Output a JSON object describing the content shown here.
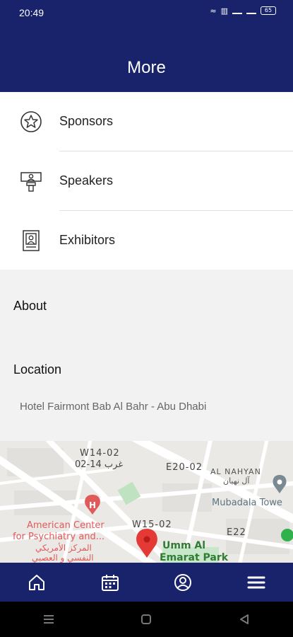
{
  "status_bar": {
    "time": "20:49",
    "battery": "65"
  },
  "header": {
    "title": "More"
  },
  "menu": {
    "items": [
      {
        "label": "Sponsors",
        "icon": "star-badge-icon"
      },
      {
        "label": "Speakers",
        "icon": "podium-speaker-icon"
      },
      {
        "label": "Exhibitors",
        "icon": "exhibitor-badge-icon"
      }
    ]
  },
  "about": {
    "title": "About"
  },
  "location": {
    "title": "Location",
    "address": "Hotel Fairmont Bab Al Bahr - Abu Dhabi"
  },
  "map": {
    "labels": {
      "w14": "W14-02",
      "w14_ar": "02-14 غرب",
      "e20": "E20-02",
      "al_nahyan": "AL NAHYAN",
      "al_nahyan_ar": "آل نهيان",
      "mubadala": "Mubadala Towe",
      "american_center_1": "American Center",
      "american_center_2": "for Psychiatry and...",
      "american_center_ar_1": "المركز الأمريكي",
      "american_center_ar_2": "النفسي و العصبي",
      "w15": "W15-02",
      "e22": "E22",
      "umm_al_1": "Umm Al",
      "umm_al_2": "Emarat Park"
    },
    "colors": {
      "marker": "#e53935",
      "park_text": "#2e7d32",
      "hospital": "#e05a5a"
    }
  },
  "bottom_nav": {
    "items": [
      {
        "icon": "home-icon"
      },
      {
        "icon": "calendar-icon"
      },
      {
        "icon": "profile-icon"
      },
      {
        "icon": "menu-icon"
      }
    ]
  },
  "colors": {
    "brand": "#18236b"
  }
}
